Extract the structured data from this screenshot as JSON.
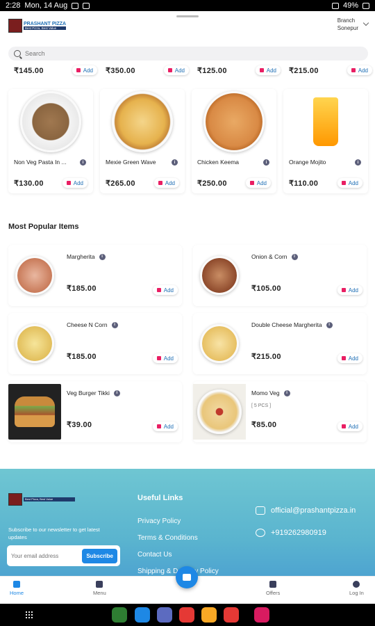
{
  "status": {
    "time": "2:28",
    "date": "Mon, 14 Aug",
    "battery": "49%"
  },
  "header": {
    "logo_name": "PRASHANT PIZZA",
    "logo_tag": "Best Pizza, Best Value",
    "branch_label": "Branch",
    "branch_value": "Sonepur"
  },
  "search": {
    "placeholder": "Search"
  },
  "top_prices": [
    {
      "price": "₹145.00",
      "add": "Add"
    },
    {
      "price": "₹350.00",
      "add": "Add"
    },
    {
      "price": "₹125.00",
      "add": "Add"
    },
    {
      "price": "₹215.00",
      "add": "Add"
    }
  ],
  "cards": [
    {
      "name": "Non Veg Pasta In ...",
      "price": "₹130.00",
      "add": "Add"
    },
    {
      "name": "Mexie Green Wave",
      "price": "₹265.00",
      "add": "Add"
    },
    {
      "name": "Chicken Keema",
      "price": "₹250.00",
      "add": "Add"
    },
    {
      "name": "Orange Mojito",
      "price": "₹110.00",
      "add": "Add"
    }
  ],
  "popular": {
    "title": "Most Popular Items",
    "items": [
      {
        "name": "Margherita",
        "sub": "",
        "price": "₹185.00",
        "add": "Add"
      },
      {
        "name": "Onion & Corn",
        "sub": "",
        "price": "₹105.00",
        "add": "Add"
      },
      {
        "name": "Cheese N Corn",
        "sub": "",
        "price": "₹185.00",
        "add": "Add"
      },
      {
        "name": "Double Cheese Margherita",
        "sub": "",
        "price": "₹215.00",
        "add": "Add"
      },
      {
        "name": "Veg Burger Tikki",
        "sub": "",
        "price": "₹39.00",
        "add": "Add"
      },
      {
        "name": "Momo Veg",
        "sub": "[ 5 PCS ]",
        "price": "₹85.00",
        "add": "Add"
      }
    ]
  },
  "footer": {
    "newsletter": "Subscribe to our newsletter to get latest updates",
    "email_placeholder": "Your email address",
    "subscribe": "Subscribe",
    "links_title": "Useful Links",
    "links": [
      "Privacy Policy",
      "Terms & Conditions",
      "Contact Us",
      "Shipping & Delivery Policy"
    ],
    "email": "official@prashantpizza.in",
    "phone": "+919262980919"
  },
  "nav": {
    "home": "Home",
    "menu": "Menu",
    "offers": "Offers",
    "login": "Log In"
  }
}
